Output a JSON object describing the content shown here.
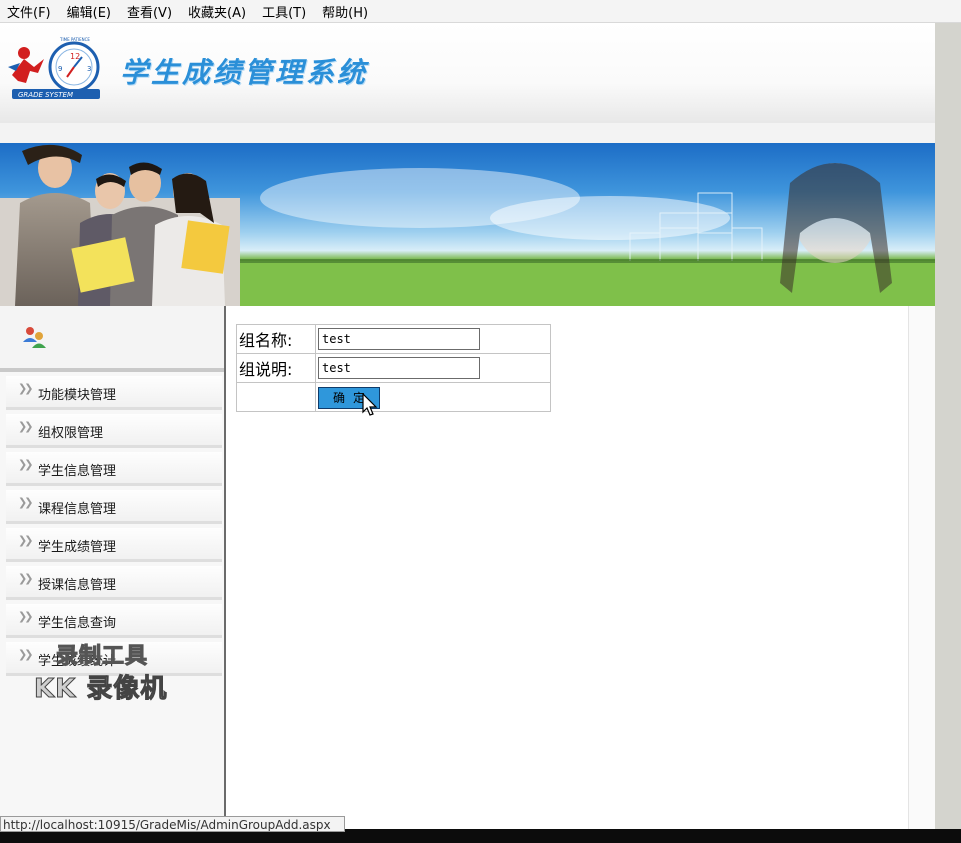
{
  "menubar": {
    "items": [
      "文件(F)",
      "编辑(E)",
      "查看(V)",
      "收藏夹(A)",
      "工具(T)",
      "帮助(H)"
    ]
  },
  "header": {
    "title": "学生成绩管理系统",
    "logo_text": "GRADE SYSTEM",
    "logo_slogan": "TIME PATIENCE"
  },
  "sidebar": {
    "items": [
      {
        "label": "功能模块管理"
      },
      {
        "label": "组权限管理"
      },
      {
        "label": "学生信息管理"
      },
      {
        "label": "课程信息管理"
      },
      {
        "label": "学生成绩管理"
      },
      {
        "label": "授课信息管理"
      },
      {
        "label": "学生信息查询"
      },
      {
        "label": "学生成绩统计"
      }
    ]
  },
  "form": {
    "group_name_label": "组名称:",
    "group_name_value": "test",
    "group_desc_label": "组说明:",
    "group_desc_value": "test",
    "submit_label": "确定"
  },
  "watermark": {
    "line1": "录制工具",
    "line2": "KK 录像机"
  },
  "statusbar": {
    "url": "http://localhost:10915/GradeMis/AdminGroupAdd.aspx"
  },
  "colors": {
    "title_blue": "#2a8fd8",
    "button_blue": "#2f97db"
  },
  "icons": {
    "users": "users-icon",
    "nav_arrow": "double-chevron-right-icon",
    "cursor": "mouse-pointer-icon"
  }
}
